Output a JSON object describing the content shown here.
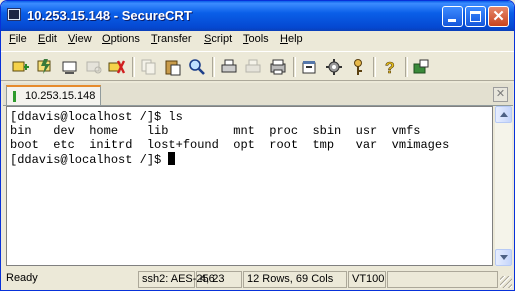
{
  "window": {
    "title": "10.253.15.148 - SecureCRT"
  },
  "titlebar_buttons": {
    "minimize_icon": "minimize-icon",
    "maximize_icon": "maximize-icon",
    "close_glyph": "✕"
  },
  "menu": {
    "items": [
      "File",
      "Edit",
      "View",
      "Options",
      "Transfer",
      "Script",
      "Tools",
      "Help"
    ]
  },
  "toolbar": {
    "icons": [
      "connect-icon",
      "quick-connect-icon",
      "connect-tab-icon",
      "reconnect-icon",
      "disconnect-icon",
      "copy-icon",
      "paste-icon",
      "find-icon",
      "print-icon",
      "print-selection-icon",
      "print-screen-icon",
      "session-options-icon",
      "global-options-icon",
      "keymap-icon",
      "help-icon",
      "sftp-icon"
    ]
  },
  "tabs": [
    {
      "label": "10.253.15.148",
      "active": true
    }
  ],
  "tab_close_glyph": "✕",
  "terminal": {
    "lines": [
      "[ddavis@localhost /]$ ls",
      "bin   dev  home    lib         mnt  proc  sbin  usr  vmfs",
      "boot  etc  initrd  lost+found  opt  root  tmp   var  vmimages",
      "[ddavis@localhost /]$ "
    ],
    "colors": {
      "background": "#ffffff",
      "foreground": "#000000"
    }
  },
  "status": {
    "ready": "Ready",
    "cipher": "ssh2: AES-256",
    "cursor_pos": "4,  23",
    "size": "12 Rows,  69 Cols",
    "terminal_type": "VT100"
  },
  "colors": {
    "title_bar": "#0a5fe8",
    "tab_accent": "#e68b2c",
    "chrome": "#ece9d8"
  }
}
